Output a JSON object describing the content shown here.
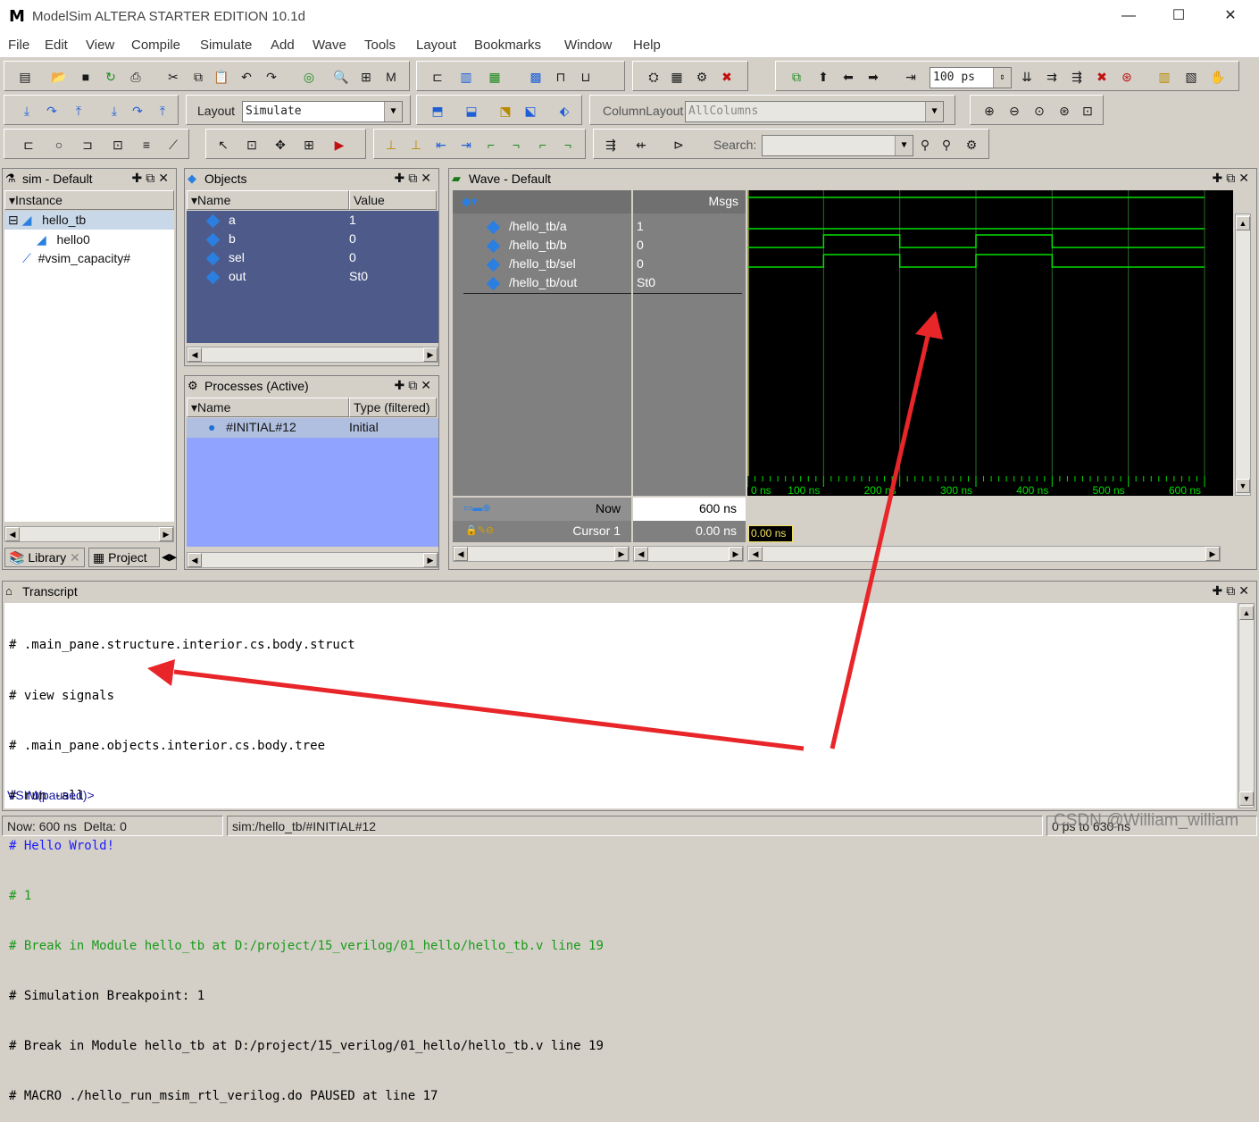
{
  "window": {
    "title": "ModelSim ALTERA STARTER EDITION 10.1d",
    "logo": "M",
    "minimize_glyph": "—",
    "maximize_glyph": "☐",
    "close_glyph": "✕"
  },
  "menu": [
    "File",
    "Edit",
    "View",
    "Compile",
    "Simulate",
    "Add",
    "Wave",
    "Tools",
    "Layout",
    "Bookmarks",
    "Window",
    "Help"
  ],
  "toolbar": {
    "resolution_value": "100",
    "resolution_unit": "ps",
    "layout_label": "Layout",
    "layout_value": "Simulate",
    "column_layout_label": "ColumnLayout",
    "column_layout_value": "AllColumns",
    "search_label": "Search:"
  },
  "sim_panel": {
    "title": "sim - Default",
    "col_instance": "Instance",
    "items": [
      "hello_tb",
      "hello0",
      "#vsim_capacity#"
    ],
    "tab_library": "Library",
    "tab_project": "Project"
  },
  "objects_panel": {
    "title": "Objects",
    "col_name": "Name",
    "col_value": "Value",
    "rows": [
      {
        "name": "a",
        "value": "1"
      },
      {
        "name": "b",
        "value": "0"
      },
      {
        "name": "sel",
        "value": "0"
      },
      {
        "name": "out",
        "value": "St0"
      }
    ]
  },
  "processes_panel": {
    "title": "Processes (Active)",
    "col_name": "Name",
    "col_type": "Type (filtered)",
    "rows": [
      {
        "name": "#INITIAL#12",
        "type": "Initial"
      }
    ]
  },
  "wave_panel": {
    "title": "Wave - Default",
    "msgs_label": "Msgs",
    "signals": [
      {
        "name": "/hello_tb/a",
        "value": "1"
      },
      {
        "name": "/hello_tb/b",
        "value": "0"
      },
      {
        "name": "/hello_tb/sel",
        "value": "0"
      },
      {
        "name": "/hello_tb/out",
        "value": "St0"
      }
    ],
    "now_label": "Now",
    "now_value": "600 ns",
    "cursor_label": "Cursor 1",
    "cursor_value": "0.00 ns",
    "cursor_tag": "0.00 ns",
    "time_ticks": [
      "0 ns",
      "100 ns",
      "200 ns",
      "300 ns",
      "400 ns",
      "500 ns",
      "600 ns"
    ],
    "trace_color": "#00e000",
    "grid_color": "#2a6a2a"
  },
  "transcript": {
    "title": "Transcript",
    "lines": [
      {
        "text": "# .main_pane.structure.interior.cs.body.struct",
        "color": "#000000"
      },
      {
        "text": "# view signals",
        "color": "#000000"
      },
      {
        "text": "# .main_pane.objects.interior.cs.body.tree",
        "color": "#000000"
      },
      {
        "text": "# run -all",
        "color": "#000000"
      },
      {
        "text": "# Hello Wrold!",
        "color": "#1a1aff"
      },
      {
        "text": "# 1",
        "color": "#1a9a1a"
      },
      {
        "text": "# Break in Module hello_tb at D:/project/15_verilog/01_hello/hello_tb.v line 19",
        "color": "#1a9a1a"
      },
      {
        "text": "# Simulation Breakpoint: 1",
        "color": "#000000"
      },
      {
        "text": "# Break in Module hello_tb at D:/project/15_verilog/01_hello/hello_tb.v line 19",
        "color": "#000000"
      },
      {
        "text": "# MACRO ./hello_run_msim_rtl_verilog.do PAUSED at line 17",
        "color": "#000000"
      }
    ],
    "prompt": "VSIM(paused)>"
  },
  "status": {
    "now": "Now: 600 ns",
    "delta": "Delta: 0",
    "context": "sim:/hello_tb/#INITIAL#12",
    "range": "0 ps to 630 ns",
    "watermark": "CSDN @William_william"
  },
  "annotation_color": "#e8262a"
}
